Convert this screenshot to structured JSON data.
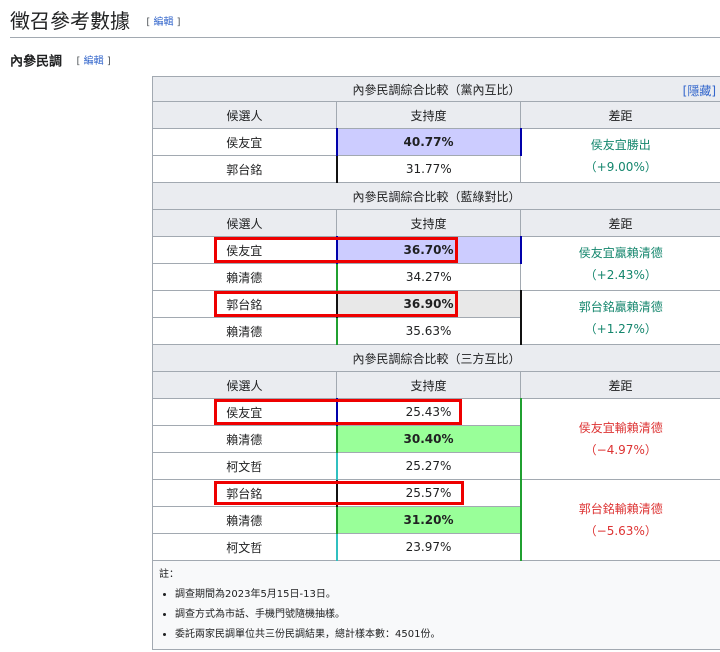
{
  "heading": {
    "title": "徵召參考數據",
    "edit": "編輯"
  },
  "subheading": {
    "title": "內參民調",
    "edit": "編輯"
  },
  "table": {
    "hide": "隱藏",
    "sections": [
      {
        "title": "內參民調綜合比較（黨內互比）",
        "headers": [
          "候選人",
          "支持度",
          "差距"
        ],
        "rows": [
          {
            "name": "侯友宜",
            "pct": "40.77%"
          },
          {
            "name": "郭台銘",
            "pct": "31.77%"
          }
        ],
        "diffs": [
          {
            "line1": "侯友宜勝出",
            "line2": "（+9.00%）"
          }
        ]
      },
      {
        "title": "內參民調綜合比較（藍綠對比）",
        "headers": [
          "候選人",
          "支持度",
          "差距"
        ],
        "rows": [
          {
            "name": "侯友宜",
            "pct": "36.70%"
          },
          {
            "name": "賴清德",
            "pct": "34.27%"
          },
          {
            "name": "郭台銘",
            "pct": "36.90%"
          },
          {
            "name": "賴清德",
            "pct": "35.63%"
          }
        ],
        "diffs": [
          {
            "line1": "侯友宜贏賴清德",
            "line2": "（+2.43%）"
          },
          {
            "line1": "郭台銘贏賴清德",
            "line2": "（+1.27%）"
          }
        ]
      },
      {
        "title": "內參民調綜合比較（三方互比）",
        "headers": [
          "候選人",
          "支持度",
          "差距"
        ],
        "rows": [
          {
            "name": "侯友宜",
            "pct": "25.43%"
          },
          {
            "name": "賴清德",
            "pct": "30.40%"
          },
          {
            "name": "柯文哲",
            "pct": "25.27%"
          },
          {
            "name": "郭台銘",
            "pct": "25.57%"
          },
          {
            "name": "賴清德",
            "pct": "31.20%"
          },
          {
            "name": "柯文哲",
            "pct": "23.97%"
          }
        ],
        "diffs": [
          {
            "line1": "侯友宜輸賴清德",
            "line2": "（−4.97%）"
          },
          {
            "line1": "郭台銘輸賴清德",
            "line2": "（−5.63%）"
          }
        ]
      }
    ],
    "notes": {
      "label": "註：",
      "items": [
        "調查期間為2023年5月15日-13日。",
        "調查方式為市話、手機門號隨機抽樣。",
        "委託兩家民調單位共三份民調結果，總計樣本數：4501份。"
      ]
    },
    "colors": {
      "kmt_fill": "#ccccff",
      "dpp_fill": "#99ff99",
      "neutral_fill": "#e8e8e8",
      "diff_win": "#14866d",
      "diff_lose": "#dd3333",
      "highlight_box": "#ee0000"
    }
  }
}
